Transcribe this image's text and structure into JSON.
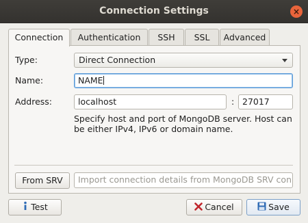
{
  "window": {
    "title": "Connection Settings",
    "close_glyph": "×"
  },
  "tabs": [
    {
      "label": "Connection",
      "active": true
    },
    {
      "label": "Authentication",
      "active": false
    },
    {
      "label": "SSH",
      "active": false
    },
    {
      "label": "SSL",
      "active": false
    },
    {
      "label": "Advanced",
      "active": false
    }
  ],
  "connection": {
    "type_label": "Type:",
    "type_value": "Direct Connection",
    "name_label": "Name:",
    "name_value": "NAME",
    "address_label": "Address:",
    "host_value": "localhost",
    "port_separator": ":",
    "port_value": "27017",
    "help_line1": "Specify host and port of MongoDB server. Host can",
    "help_line2": "be either IPv4, IPv6 or domain name."
  },
  "srv": {
    "button_label": "From SRV",
    "input_placeholder": "Import connection details from MongoDB SRV con..."
  },
  "footer": {
    "test_label": "Test",
    "cancel_label": "Cancel",
    "save_label": "Save"
  },
  "icons": {
    "test": "info-icon",
    "cancel": "cancel-x-icon",
    "save": "floppy-disk-icon"
  },
  "colors": {
    "titlebar": "#3a3835",
    "close_button": "#e9643b",
    "focus": "#5e9cd8",
    "cancel_icon": "#c0262d",
    "save_icon": "#2f6bb5"
  }
}
